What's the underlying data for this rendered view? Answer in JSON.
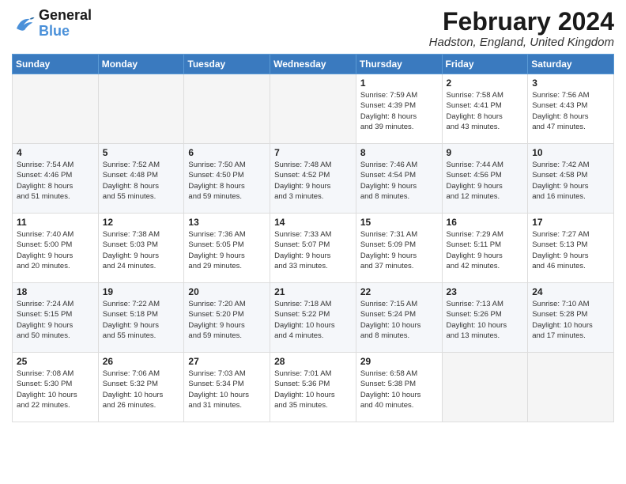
{
  "logo": {
    "line1": "General",
    "line2": "Blue"
  },
  "title": "February 2024",
  "location": "Hadston, England, United Kingdom",
  "days_of_week": [
    "Sunday",
    "Monday",
    "Tuesday",
    "Wednesday",
    "Thursday",
    "Friday",
    "Saturday"
  ],
  "weeks": [
    [
      {
        "day": "",
        "info": ""
      },
      {
        "day": "",
        "info": ""
      },
      {
        "day": "",
        "info": ""
      },
      {
        "day": "",
        "info": ""
      },
      {
        "day": "1",
        "info": "Sunrise: 7:59 AM\nSunset: 4:39 PM\nDaylight: 8 hours\nand 39 minutes."
      },
      {
        "day": "2",
        "info": "Sunrise: 7:58 AM\nSunset: 4:41 PM\nDaylight: 8 hours\nand 43 minutes."
      },
      {
        "day": "3",
        "info": "Sunrise: 7:56 AM\nSunset: 4:43 PM\nDaylight: 8 hours\nand 47 minutes."
      }
    ],
    [
      {
        "day": "4",
        "info": "Sunrise: 7:54 AM\nSunset: 4:46 PM\nDaylight: 8 hours\nand 51 minutes."
      },
      {
        "day": "5",
        "info": "Sunrise: 7:52 AM\nSunset: 4:48 PM\nDaylight: 8 hours\nand 55 minutes."
      },
      {
        "day": "6",
        "info": "Sunrise: 7:50 AM\nSunset: 4:50 PM\nDaylight: 8 hours\nand 59 minutes."
      },
      {
        "day": "7",
        "info": "Sunrise: 7:48 AM\nSunset: 4:52 PM\nDaylight: 9 hours\nand 3 minutes."
      },
      {
        "day": "8",
        "info": "Sunrise: 7:46 AM\nSunset: 4:54 PM\nDaylight: 9 hours\nand 8 minutes."
      },
      {
        "day": "9",
        "info": "Sunrise: 7:44 AM\nSunset: 4:56 PM\nDaylight: 9 hours\nand 12 minutes."
      },
      {
        "day": "10",
        "info": "Sunrise: 7:42 AM\nSunset: 4:58 PM\nDaylight: 9 hours\nand 16 minutes."
      }
    ],
    [
      {
        "day": "11",
        "info": "Sunrise: 7:40 AM\nSunset: 5:00 PM\nDaylight: 9 hours\nand 20 minutes."
      },
      {
        "day": "12",
        "info": "Sunrise: 7:38 AM\nSunset: 5:03 PM\nDaylight: 9 hours\nand 24 minutes."
      },
      {
        "day": "13",
        "info": "Sunrise: 7:36 AM\nSunset: 5:05 PM\nDaylight: 9 hours\nand 29 minutes."
      },
      {
        "day": "14",
        "info": "Sunrise: 7:33 AM\nSunset: 5:07 PM\nDaylight: 9 hours\nand 33 minutes."
      },
      {
        "day": "15",
        "info": "Sunrise: 7:31 AM\nSunset: 5:09 PM\nDaylight: 9 hours\nand 37 minutes."
      },
      {
        "day": "16",
        "info": "Sunrise: 7:29 AM\nSunset: 5:11 PM\nDaylight: 9 hours\nand 42 minutes."
      },
      {
        "day": "17",
        "info": "Sunrise: 7:27 AM\nSunset: 5:13 PM\nDaylight: 9 hours\nand 46 minutes."
      }
    ],
    [
      {
        "day": "18",
        "info": "Sunrise: 7:24 AM\nSunset: 5:15 PM\nDaylight: 9 hours\nand 50 minutes."
      },
      {
        "day": "19",
        "info": "Sunrise: 7:22 AM\nSunset: 5:18 PM\nDaylight: 9 hours\nand 55 minutes."
      },
      {
        "day": "20",
        "info": "Sunrise: 7:20 AM\nSunset: 5:20 PM\nDaylight: 9 hours\nand 59 minutes."
      },
      {
        "day": "21",
        "info": "Sunrise: 7:18 AM\nSunset: 5:22 PM\nDaylight: 10 hours\nand 4 minutes."
      },
      {
        "day": "22",
        "info": "Sunrise: 7:15 AM\nSunset: 5:24 PM\nDaylight: 10 hours\nand 8 minutes."
      },
      {
        "day": "23",
        "info": "Sunrise: 7:13 AM\nSunset: 5:26 PM\nDaylight: 10 hours\nand 13 minutes."
      },
      {
        "day": "24",
        "info": "Sunrise: 7:10 AM\nSunset: 5:28 PM\nDaylight: 10 hours\nand 17 minutes."
      }
    ],
    [
      {
        "day": "25",
        "info": "Sunrise: 7:08 AM\nSunset: 5:30 PM\nDaylight: 10 hours\nand 22 minutes."
      },
      {
        "day": "26",
        "info": "Sunrise: 7:06 AM\nSunset: 5:32 PM\nDaylight: 10 hours\nand 26 minutes."
      },
      {
        "day": "27",
        "info": "Sunrise: 7:03 AM\nSunset: 5:34 PM\nDaylight: 10 hours\nand 31 minutes."
      },
      {
        "day": "28",
        "info": "Sunrise: 7:01 AM\nSunset: 5:36 PM\nDaylight: 10 hours\nand 35 minutes."
      },
      {
        "day": "29",
        "info": "Sunrise: 6:58 AM\nSunset: 5:38 PM\nDaylight: 10 hours\nand 40 minutes."
      },
      {
        "day": "",
        "info": ""
      },
      {
        "day": "",
        "info": ""
      }
    ]
  ]
}
